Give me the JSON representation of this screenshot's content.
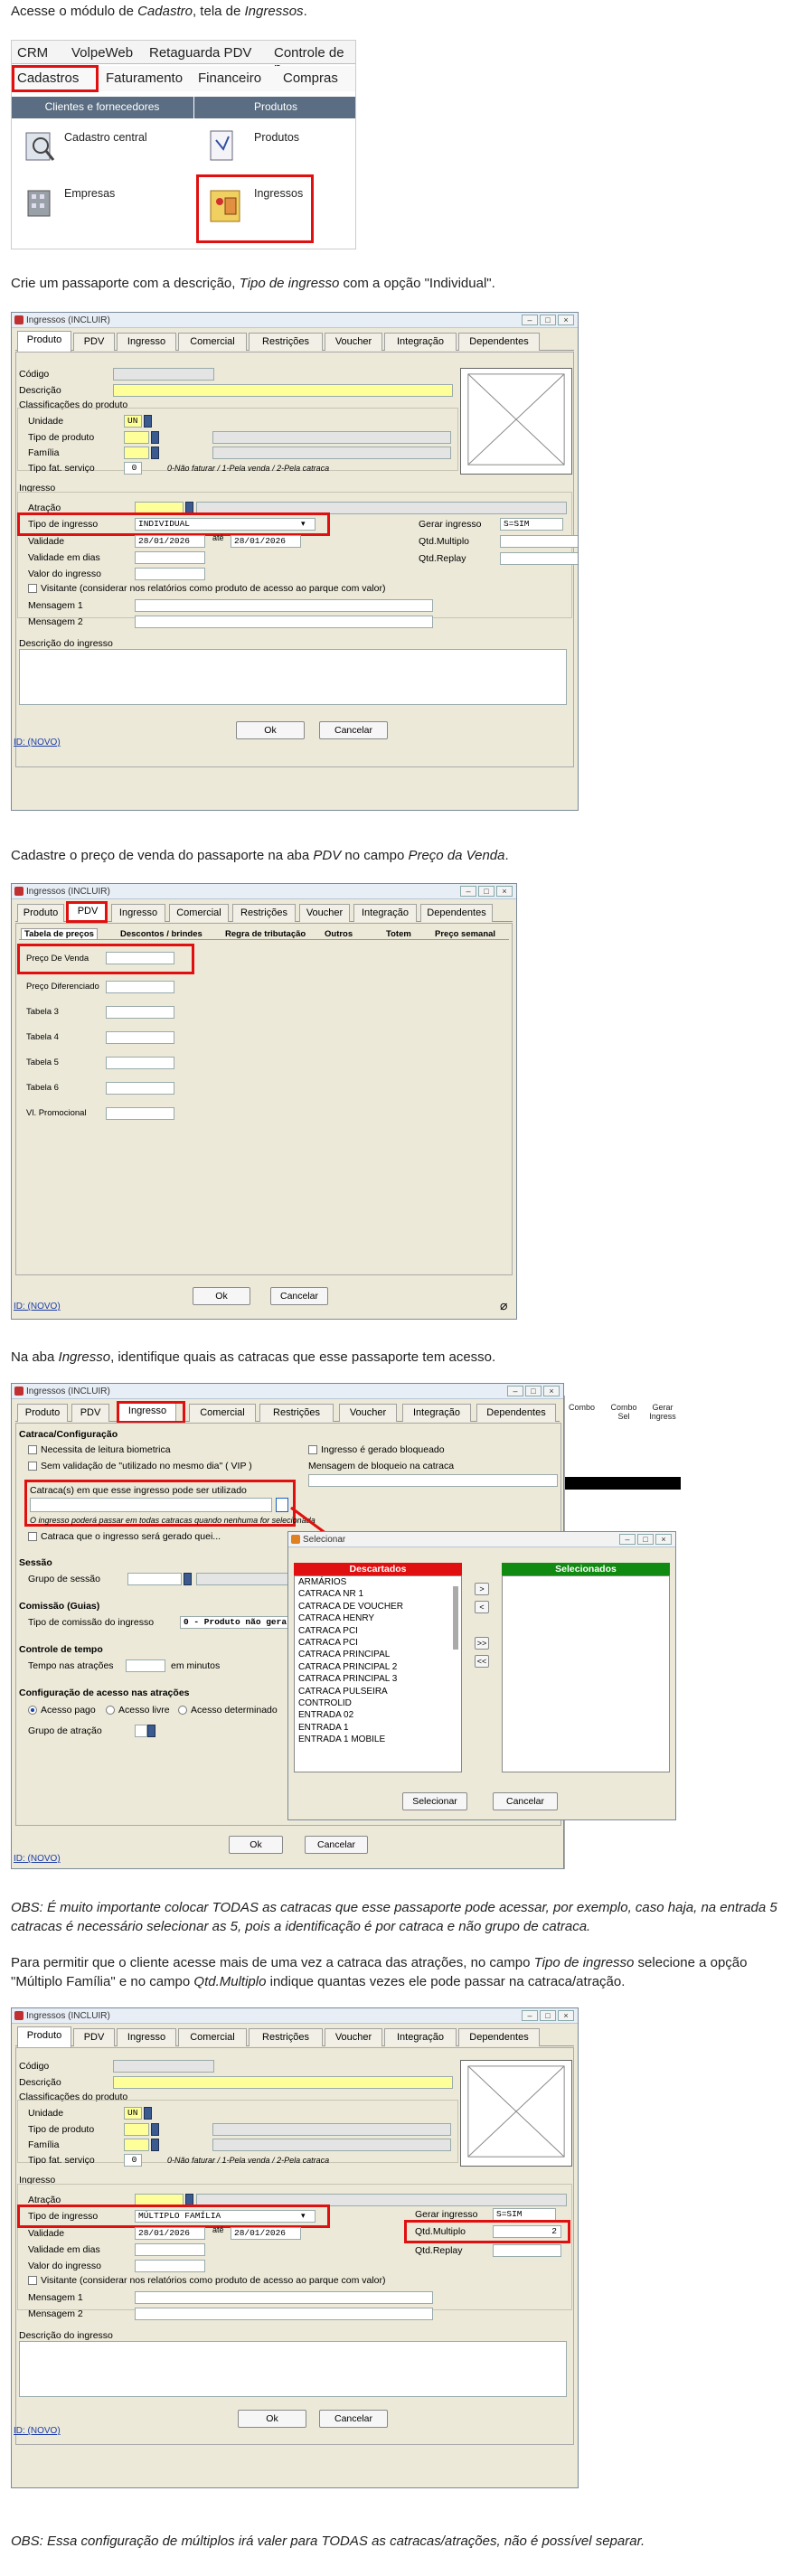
{
  "texts": {
    "p1a": "Acesse o módulo de ",
    "p1b": "Cadastro",
    "p1c": ", tela de ",
    "p1d": "Ingressos",
    "p1e": ".",
    "p2a": "Crie um passaporte com a descrição, ",
    "p2b": "Tipo de ingresso",
    "p2c": " com a opção \"Individual\".",
    "p3a": "Cadastre o preço de venda do passaporte na aba ",
    "p3b": "PDV",
    "p3c": " no campo ",
    "p3d": "Preço da Venda",
    "p3e": ".",
    "p4a": "Na aba ",
    "p4b": "Ingresso",
    "p4c": ", identifique quais as catracas que esse passaporte tem acesso.",
    "obs1": "OBS: É muito importante colocar TODAS as catracas que esse passaporte pode acessar, por exemplo, caso haja, na entrada 5 catracas é necessário selecionar as 5, pois a identificação é por catraca e não grupo de catraca.",
    "p5a": "Para permitir que o cliente acesse mais de uma vez a catraca das atrações, no campo ",
    "p5b": "Tipo de ingresso",
    "p5c": " selecione a opção \"Múltiplo Família\" e no campo ",
    "p5d": "Qtd.Multiplo",
    "p5e": "  indique quantas vezes ele pode passar na  catraca/atração.",
    "obs2": "OBS: Essa configuração de múltiplos irá valer para TODAS as catracas/atrações, não é possível separar."
  },
  "menu": {
    "top": [
      "CRM",
      "VolpeWeb",
      "Retaguarda PDV",
      "Controle de p"
    ],
    "second": [
      "Cadastros",
      "Faturamento",
      "Financeiro",
      "Compras"
    ],
    "headers": [
      "Clientes e fornecedores",
      "Produtos"
    ],
    "items": [
      "Cadastro central",
      "Produtos",
      "Empresas",
      "Ingressos"
    ]
  },
  "form1": {
    "title": "Ingressos (INCLUIR)",
    "tabs": [
      "Produto",
      "PDV",
      "Ingresso",
      "Comercial",
      "Restrições",
      "Voucher",
      "Integração",
      "Dependentes"
    ],
    "codigo": "Código",
    "descricao": "Descrição",
    "classificacoes": "Classificações do produto",
    "unidade": "Unidade",
    "unidade_val": "UN",
    "tipo_produto": "Tipo de produto",
    "familia": "Família",
    "tipo_fat": "Tipo fat. serviço",
    "tipo_fat_val": "0",
    "tipo_fat_hint": "0-Não faturar / 1-Pela venda / 2-Pela catraca",
    "ingresso": "Ingresso",
    "atracao": "Atração",
    "tipo_ingresso": "Tipo de ingresso",
    "tipo_ingresso_val": "INDIVIDUAL",
    "validade": "Validade",
    "validade_de": "28/01/2026",
    "ate": "até",
    "validade_ate": "28/01/2026",
    "validade_dias": "Validade em dias",
    "valor": "Valor do ingresso",
    "visitante": "Visitante (considerar nos relatórios como produto de acesso ao parque com valor)",
    "msg1": "Mensagem 1",
    "msg2": "Mensagem 2",
    "gerar": "Gerar ingresso",
    "gerar_val": "S=SIM",
    "qtd_multiplo": "Qtd.Multiplo",
    "qtd_replay": "Qtd.Replay",
    "descricao_ingresso": "Descrição do ingresso",
    "ok": "Ok",
    "cancelar": "Cancelar",
    "id": "ID: (NOVO)"
  },
  "form2": {
    "title": "Ingressos (INCLUIR)",
    "tabs": [
      "Produto",
      "PDV",
      "Ingresso",
      "Comercial",
      "Restrições",
      "Voucher",
      "Integração",
      "Dependentes"
    ],
    "subtabs": [
      "Tabela de preços",
      "Descontos / brindes",
      "Regra de tributação",
      "Outros",
      "Totem",
      "Preço semanal"
    ],
    "rows": [
      "Preço De Venda",
      "Preço Diferenciado",
      "Tabela 3",
      "Tabela 4",
      "Tabela 5",
      "Tabela 6",
      "Vl. Promocional"
    ],
    "ok": "Ok",
    "cancelar": "Cancelar",
    "id": "ID: (NOVO)"
  },
  "form3": {
    "title": "Ingressos (INCLUIR)",
    "tabs": [
      "Produto",
      "PDV",
      "Ingresso",
      "Comercial",
      "Restrições",
      "Voucher",
      "Integração",
      "Dependentes"
    ],
    "section_catraca": "Catraca/Configuração",
    "chk_bio": "Necessita de leitura biometrica",
    "chk_sem": "Sem validação de \"utilizado no mesmo dia\" ( VIP )",
    "chk_bloq": "Ingresso é gerado bloqueado",
    "msg_bloq": "Mensagem de bloqueio na catraca",
    "catracas_label": "Catraca(s) em que esse ingresso pode ser utilizado",
    "catracas_hint": "O ingresso poderá passar em todas catracas quando nenhuma for selecionada",
    "chk_gerado": "Catraca que o ingresso será gerado quei...",
    "sessao": "Sessão",
    "grupo_sessao": "Grupo de sessão",
    "comissao": "Comissão (Guias)",
    "tipo_comissao": "Tipo de comissão do ingresso",
    "tipo_comissao_val": "0 - Produto não gera",
    "controle_tempo": "Controle de tempo",
    "tempo_atracoes": "Tempo nas atrações",
    "em_minutos": "em minutos",
    "config_acesso": "Configuração de acesso nas atrações",
    "rad_pago": "Acesso pago",
    "rad_livre": "Acesso livre",
    "rad_det": "Acesso determinado",
    "grupo_atracao": "Grupo de atração",
    "ok": "Ok",
    "cancelar": "Cancelar",
    "id": "ID: (NOVO)",
    "grid_head": [
      "Combo",
      "Combo Sel",
      "Gerar Ingress"
    ]
  },
  "selecionar": {
    "title": "Selecionar",
    "descartados": "Descartados",
    "selecionados": "Selecionados",
    "items": [
      "ARMÁRIOS",
      "CATRACA NR 1",
      "CATRACA DE VOUCHER",
      "CATRACA HENRY",
      "CATRACA PCI",
      "CATRACA PCI",
      "CATRACA PRINCIPAL",
      "CATRACA PRINCIPAL 2",
      "CATRACA PRINCIPAL 3",
      "CATRACA PULSEIRA",
      "CONTROLID",
      "ENTRADA 02",
      "ENTRADA 1",
      "ENTRADA 1 MOBILE"
    ],
    "btn_add": ">",
    "btn_rem": "<",
    "btn_addall": ">>",
    "btn_remall": "<<",
    "selecionar": "Selecionar",
    "cancelar": "Cancelar"
  },
  "form4": {
    "title": "Ingressos (INCLUIR)",
    "tabs": [
      "Produto",
      "PDV",
      "Ingresso",
      "Comercial",
      "Restrições",
      "Voucher",
      "Integração",
      "Dependentes"
    ],
    "codigo": "Código",
    "descricao": "Descrição",
    "classificacoes": "Classificações do produto",
    "unidade": "Unidade",
    "unidade_val": "UN",
    "tipo_produto": "Tipo de produto",
    "familia": "Família",
    "tipo_fat": "Tipo fat. serviço",
    "tipo_fat_val": "0",
    "tipo_fat_hint": "0-Não faturar / 1-Pela venda / 2-Pela catraca",
    "ingresso": "Ingresso",
    "atracao": "Atração",
    "tipo_ingresso": "Tipo de ingresso",
    "tipo_ingresso_val": "MÚLTIPLO FAMÍLIA",
    "validade": "Validade",
    "validade_de": "28/01/2026",
    "ate": "até",
    "validade_ate": "28/01/2026",
    "validade_dias": "Validade em dias",
    "valor": "Valor do ingresso",
    "visitante": "Visitante (considerar nos relatórios como produto de acesso ao parque com valor)",
    "msg1": "Mensagem 1",
    "msg2": "Mensagem 2",
    "gerar": "Gerar ingresso",
    "gerar_val": "S=SIM",
    "qtd_multiplo": "Qtd.Multiplo",
    "qtd_multiplo_val": "2",
    "qtd_replay": "Qtd.Replay",
    "descricao_ingresso": "Descrição do ingresso",
    "ok": "Ok",
    "cancelar": "Cancelar",
    "id": "ID: (NOVO)"
  },
  "colors": {
    "highlight": "#e01010",
    "yellow_field": "#ffff99",
    "menu_blue": "#5a6d82"
  }
}
